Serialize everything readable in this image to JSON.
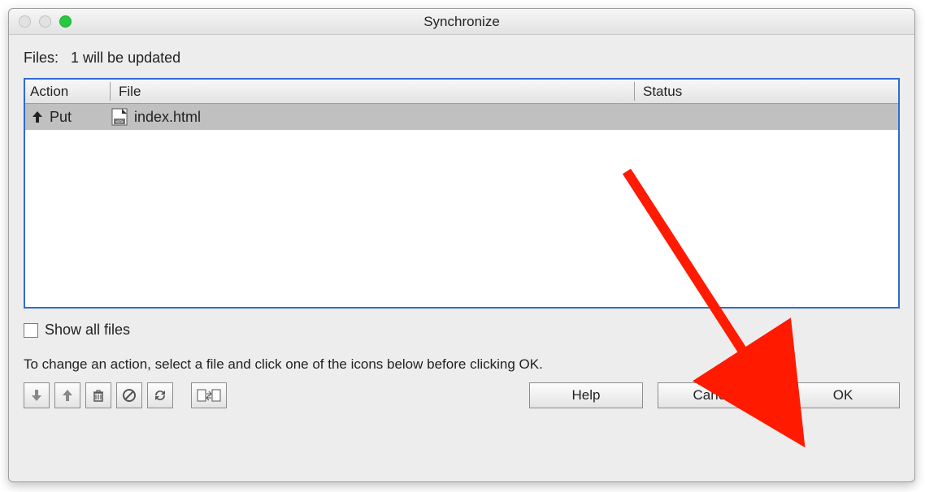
{
  "window": {
    "title": "Synchronize"
  },
  "summary": {
    "label_prefix": "Files:",
    "text": "1 will be updated"
  },
  "columns": {
    "action": "Action",
    "file": "File",
    "status": "Status"
  },
  "rows": [
    {
      "action": "Put",
      "file": "index.html",
      "status": ""
    }
  ],
  "checkbox": {
    "show_all_files_label": "Show all files",
    "checked": false
  },
  "instruction": "To change an action, select a file and click one of the icons below before clicking OK.",
  "toolbarIcons": {
    "get": "get-icon",
    "put": "put-icon",
    "delete": "delete-icon",
    "ignore": "ignore-icon",
    "synchronize": "synchronize-icon",
    "compare": "compare-icon"
  },
  "buttons": {
    "help": "Help",
    "cancel": "Cancel",
    "ok": "OK"
  }
}
